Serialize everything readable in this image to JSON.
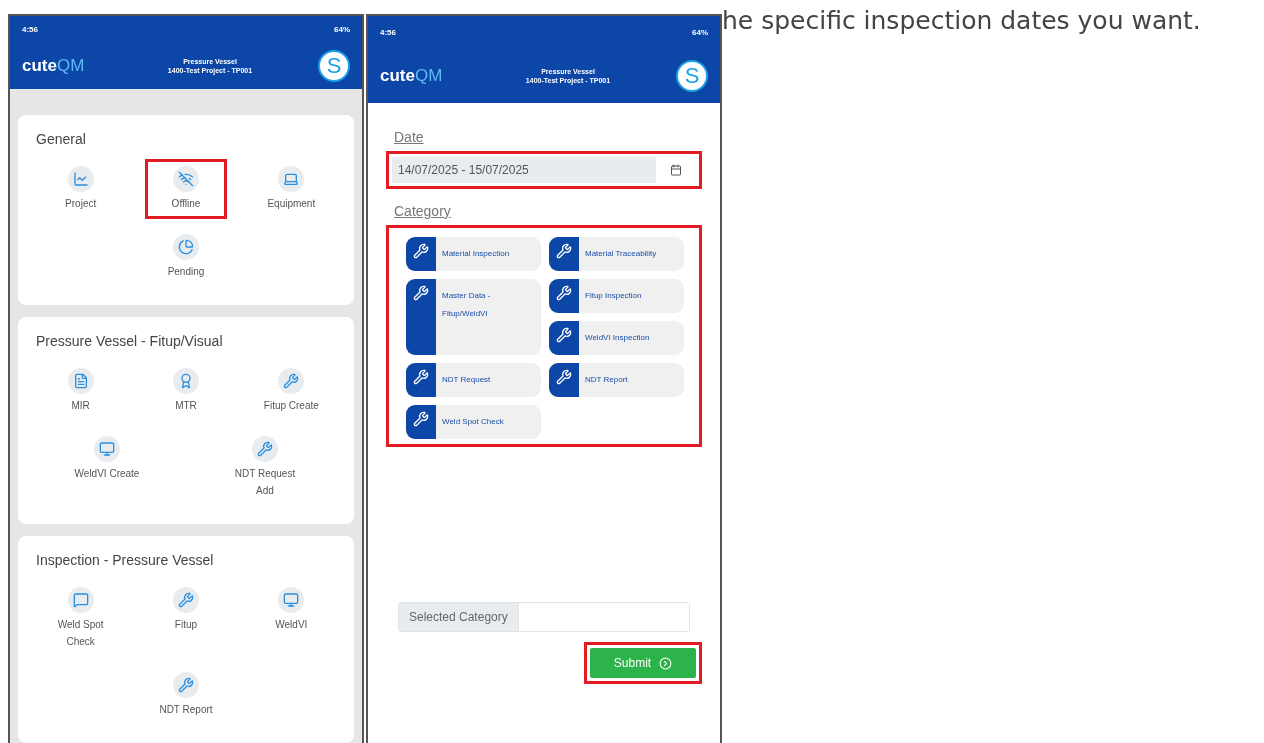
{
  "caption": "he specific inspection dates you want.",
  "phones": [
    {
      "status": {
        "time": "4:56",
        "battery": "64%"
      },
      "header": {
        "logo": {
          "main": "cute",
          "accent": "QM"
        },
        "title": "Pressure Vessel",
        "subtitle": "1400-Test Project - TP001",
        "avatar": "S"
      },
      "sections": [
        {
          "title": "General",
          "items": [
            {
              "label": "Project",
              "highlighted": false
            },
            {
              "label": "Offline",
              "highlighted": true
            },
            {
              "label": "Equipment",
              "highlighted": false
            },
            {
              "label": "Pending",
              "highlighted": false
            }
          ]
        },
        {
          "title": "Pressure Vessel - Fitup/Visual",
          "items": [
            {
              "label": "MIR",
              "highlighted": false
            },
            {
              "label": "MTR",
              "highlighted": false
            },
            {
              "label": "Fitup Create",
              "highlighted": false
            },
            {
              "label": "WeldVI Create",
              "highlighted": false
            },
            {
              "label": "NDT Request Add",
              "highlighted": false
            }
          ]
        },
        {
          "title": "Inspection - Pressure Vessel",
          "items": [
            {
              "label": "Weld Spot Check",
              "highlighted": false
            },
            {
              "label": "Fitup",
              "highlighted": false
            },
            {
              "label": "WeldVI",
              "highlighted": false
            },
            {
              "label": "NDT Report",
              "highlighted": false
            }
          ]
        }
      ]
    },
    {
      "status": {
        "time": "4:56",
        "battery": "64%"
      },
      "header": {
        "logo": {
          "main": "cute",
          "accent": "QM"
        },
        "title": "Pressure Vessel",
        "subtitle": "1400-Test Project - TP001",
        "avatar": "S"
      },
      "form": {
        "date_label": "Date",
        "date": {
          "value": "14/07/2025 - 15/07/2025",
          "highlighted": true
        },
        "category_label": "Category",
        "categories_highlighted": true,
        "categories": [
          {
            "label": "Material Inspection"
          },
          {
            "label": "Material Traceability"
          },
          {
            "label": "Master Data - Fitup/WeldVI"
          },
          {
            "label": "Fitup Inspection"
          },
          {
            "label": "WeldVI Inspection"
          },
          {
            "label": "NDT Request"
          },
          {
            "label": "NDT Report"
          },
          {
            "label": "Weld Spot Check"
          }
        ],
        "selected_label": "Selected Category",
        "submit": {
          "label": "Submit",
          "highlighted": true
        }
      }
    }
  ]
}
